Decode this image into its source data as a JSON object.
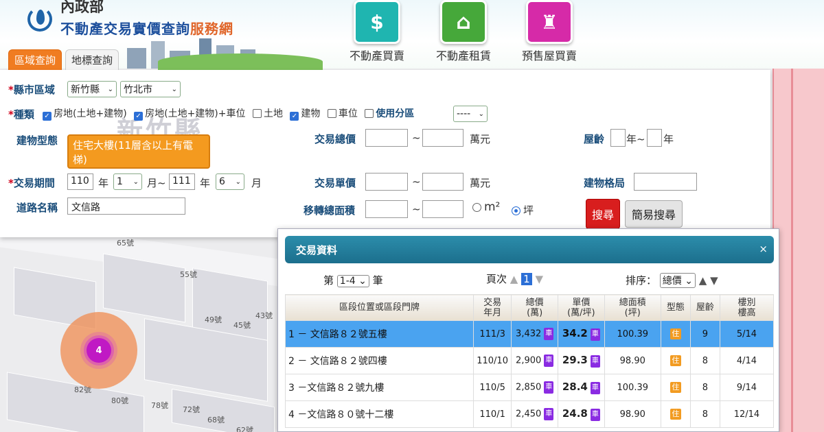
{
  "header": {
    "ministry": "內政部",
    "site_title_a": "不動產交易實價查詢",
    "site_title_b": "服務網",
    "tabs": [
      "區域查詢",
      "地標查詢"
    ],
    "nav": [
      {
        "label": "不動產買賣",
        "color": "#1fb5b0",
        "icon": "house-dollar-icon",
        "glyph": "$"
      },
      {
        "label": "不動產租賃",
        "color": "#46a83a",
        "icon": "house-for-rent-icon",
        "glyph": "⌂"
      },
      {
        "label": "預售屋買賣",
        "color": "#d62aa8",
        "icon": "crane-house-icon",
        "glyph": "♜"
      }
    ]
  },
  "form": {
    "county_label": "縣市區域",
    "county": "新竹縣",
    "district": "竹北市",
    "type_label": "種類",
    "types": [
      {
        "label": "房地(土地+建物)",
        "checked": true
      },
      {
        "label": "房地(土地+建物)+車位",
        "checked": true
      },
      {
        "label": "土地",
        "checked": false
      },
      {
        "label": "建物",
        "checked": true
      },
      {
        "label": "車位",
        "checked": false
      }
    ],
    "zoning_label": "使用分區",
    "zoning_value": "----",
    "building_type_label": "建物型態",
    "building_type": "住宅大樓(11層含以上有電梯)",
    "total_price_label": "交易總價",
    "unit_wan": "萬元",
    "unit_price_label": "交易單價",
    "transfer_area_label": "移轉總面積",
    "m2": "m²",
    "ping": "坪",
    "age_label": "屋齡",
    "year_sep": "年~",
    "year": "年",
    "layout_label": "建物格局",
    "period_label": "交易期間",
    "from_year": "110",
    "from_month": "1",
    "to_year": "111",
    "to_month": "6",
    "year_word": "年",
    "month_sep": "月~",
    "month_word": "月",
    "road_label": "道路名稱",
    "road": "文信路",
    "range_sep": "~",
    "search_btn": "搜尋",
    "simple_btn": "簡易搜尋"
  },
  "map": {
    "labels": [
      "65號",
      "55號",
      "49號",
      "45號",
      "43號",
      "82號",
      "80號",
      "78號",
      "72號",
      "68號",
      "62號",
      "新竹縣"
    ],
    "cluster_count": "4"
  },
  "results": {
    "title": "交易資料",
    "close": "×",
    "range_pre": "第",
    "range_value": "1-4",
    "range_post": "筆",
    "page_label": "頁次",
    "page_value": "1",
    "sort_label": "排序：",
    "sort_value": "總價",
    "columns": [
      "區段位置或區段門牌",
      "交易\n年月",
      "總價\n(萬)",
      "單價\n(萬/坪)",
      "總面積\n(坪)",
      "型態",
      "屋齡",
      "樓別\n樓高"
    ],
    "rows": [
      {
        "addr": "1 － 文信路８２號五樓",
        "ym": "111/3",
        "total": "3,432",
        "unit": "34.2",
        "area": "100.39",
        "type": "住",
        "age": "9",
        "floor": "5/14"
      },
      {
        "addr": "2 － 文信路８２號四樓",
        "ym": "110/10",
        "total": "2,900",
        "unit": "29.3",
        "area": "98.90",
        "type": "住",
        "age": "8",
        "floor": "4/14"
      },
      {
        "addr": "3 －文信路８２號九樓",
        "ym": "110/5",
        "total": "2,850",
        "unit": "28.4",
        "area": "100.39",
        "type": "住",
        "age": "8",
        "floor": "9/14"
      },
      {
        "addr": "4 －文信路８０號十二樓",
        "ym": "110/1",
        "total": "2,450",
        "unit": "24.8",
        "area": "98.90",
        "type": "住",
        "age": "8",
        "floor": "12/14"
      }
    ],
    "chip": "車"
  }
}
